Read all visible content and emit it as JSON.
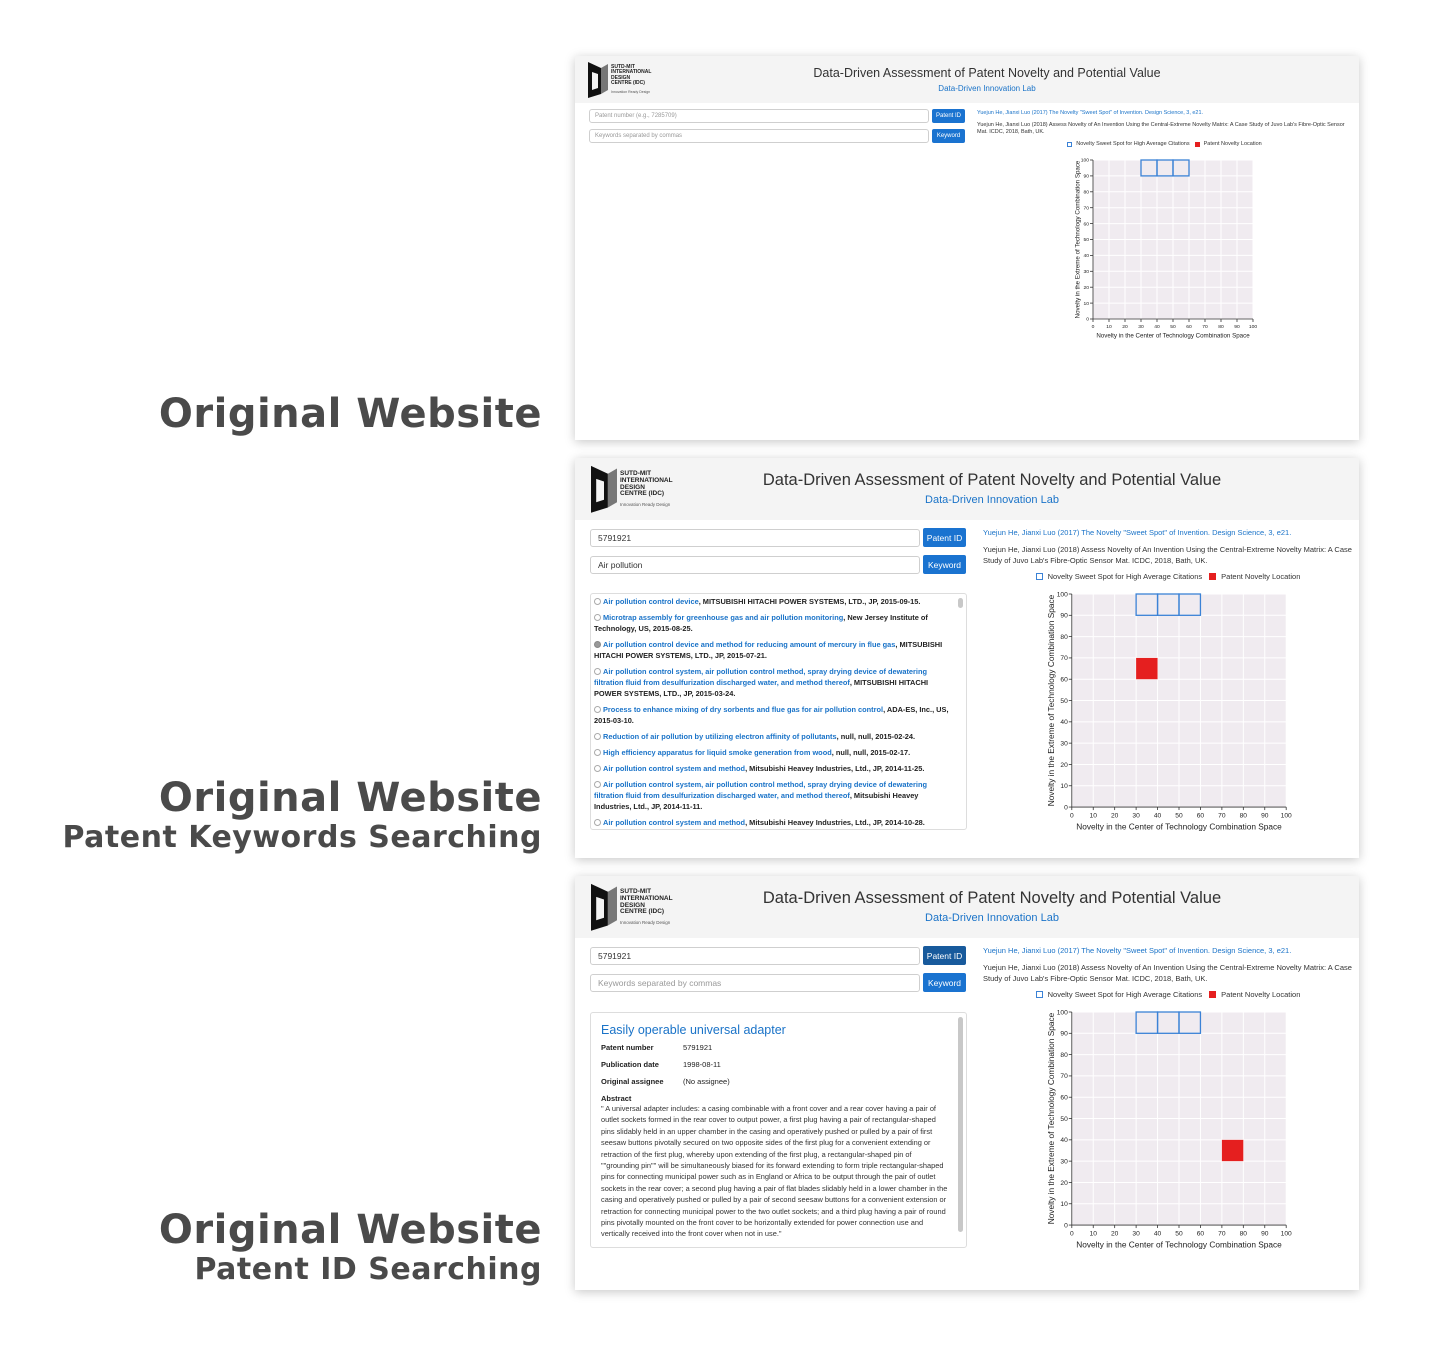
{
  "captions": [
    {
      "main": "Original Website",
      "sub": ""
    },
    {
      "main": "Original Website",
      "sub": "Patent Keywords Searching"
    },
    {
      "main": "Original Website",
      "sub": "Patent ID Searching"
    }
  ],
  "header": {
    "logo_lines": [
      "SUTD-MIT",
      "INTERNATIONAL",
      "DESIGN",
      "CENTRE (IDC)"
    ],
    "logo_tagline": "Innovation Ready Design",
    "title": "Data-Driven Assessment of Patent Novelty and Potential Value",
    "subtitle": "Data-Driven Innovation Lab"
  },
  "search": {
    "patent_placeholder": "Patent number (e.g., 7285709)",
    "keyword_placeholder": "Keywords separated by commas",
    "patent_button": "Patent ID",
    "keyword_button": "Keyword"
  },
  "references": {
    "ref1": "Yuejun He, Jianxi Luo (2017) The Novelty \"Sweet Spot\" of Invention. Design Science, 3, e21.",
    "ref2": "Yuejun He, Jianxi Luo (2018) Assess Novelty of An Invention Using the Central-Extreme Novelty Matrix: A Case Study of Juvo Lab's Fibre-Optic Sensor Mat. ICDC, 2018, Bath, UK."
  },
  "legend": {
    "sweet_spot": "Novelty Sweet Spot for High Average Citations",
    "location": "Patent Novelty Location"
  },
  "screens": [
    {
      "patent_value": "",
      "keyword_value": ""
    },
    {
      "patent_value": "5791921",
      "keyword_value": "Air pollution",
      "results": [
        {
          "title": "Air pollution control device",
          "rest": ", MITSUBISHI HITACHI POWER SYSTEMS, LTD., JP, 2015-09-15.",
          "selected": false
        },
        {
          "title": "Microtrap assembly for greenhouse gas and air pollution monitoring",
          "rest": ", New Jersey Institute of Technology, US, 2015-08-25.",
          "selected": false
        },
        {
          "title": "Air pollution control device and method for reducing amount of mercury in flue gas",
          "rest": ", MITSUBISHI HITACHI POWER SYSTEMS, LTD., JP, 2015-07-21.",
          "selected": true
        },
        {
          "title": "Air pollution control system, air pollution control method, spray drying device of dewatering filtration fluid from desulfurization discharged water, and method thereof",
          "rest": ", MITSUBISHI HITACHI POWER SYSTEMS, LTD., JP, 2015-03-24.",
          "selected": false
        },
        {
          "title": "Process to enhance mixing of dry sorbents and flue gas for air pollution control",
          "rest": ", ADA-ES, Inc., US, 2015-03-10.",
          "selected": false
        },
        {
          "title": "Reduction of air pollution by utilizing electron affinity of pollutants",
          "rest": ", null, null, 2015-02-24.",
          "selected": false
        },
        {
          "title": "High efficiency apparatus for liquid smoke generation from wood",
          "rest": ", null, null, 2015-02-17.",
          "selected": false
        },
        {
          "title": "Air pollution control system and method",
          "rest": ", Mitsubishi Heavey Industries, Ltd., JP, 2014-11-25.",
          "selected": false
        },
        {
          "title": "Air pollution control system, air pollution control method, spray drying device of dewatering filtration fluid from desulfurization discharged water, and method thereof",
          "rest": ", Mitsubishi Heavey Industries, Ltd., JP, 2014-11-11.",
          "selected": false
        },
        {
          "title": "Air pollution control system and method",
          "rest": ", Mitsubishi Heavey Industries, Ltd., JP, 2014-10-28.",
          "selected": false
        }
      ]
    },
    {
      "patent_value": "5791921",
      "keyword_value": "",
      "detail": {
        "title": "Easily operable universal adapter",
        "fields": [
          {
            "key": "Patent number",
            "value": "5791921"
          },
          {
            "key": "Publication date",
            "value": "1998-08-11"
          },
          {
            "key": "Original assignee",
            "value": "(No assignee)"
          }
        ],
        "abstract_label": "Abstract",
        "abstract": "\" A universal adapter includes: a casing combinable with a front cover and a rear cover having a pair of outlet sockets formed in the rear cover to output power, a first plug having a pair of rectangular-shaped pins slidably held in an upper chamber in the casing and operatively pushed or pulled by a pair of first seesaw buttons pivotally secured on two opposite sides of the first plug for a convenient extending or retraction of the first plug, whereby upon extending of the first plug, a rectangular-shaped pin of \"\"grounding pin\"\" will be simultaneously biased for its forward extending to form triple rectangular-shaped pins for connecting municipal power such as in England or Africa to be output through the pair of outlet sockets in the rear cover; a second plug having a pair of flat blades slidably held in a lower chamber in the casing and operatively pushed or pulled by a pair of second seesaw buttons for a convenient extension or retraction for connecting municipal power to the two outlet sockets; and a third plug having a pair of round pins pivotally mounted on the front cover to be horizontally extended for power connection use and vertically received into the front cover when not in use.\""
      }
    }
  ],
  "colors": {
    "accent": "#1a73d0",
    "sweet_spot": "#3b82d6",
    "location": "#e51f1f",
    "plot_bg": "#f0ebf0"
  },
  "chart_data": [
    {
      "type": "scatter",
      "title": "",
      "xlabel": "Novelty in the Center of Technology Combination Space",
      "ylabel": "Novelty in the Extreme of Technology Combination Space",
      "xlim": [
        0,
        100
      ],
      "ylim": [
        0,
        100
      ],
      "xticks": [
        0,
        10,
        20,
        30,
        40,
        50,
        60,
        70,
        80,
        90,
        100
      ],
      "yticks": [
        0,
        10,
        20,
        30,
        40,
        50,
        60,
        70,
        80,
        90,
        100
      ],
      "grid": true,
      "legend": "top",
      "sweet_spot_cells": [
        {
          "x": [
            30,
            40
          ],
          "y": [
            90,
            100
          ]
        },
        {
          "x": [
            40,
            50
          ],
          "y": [
            90,
            100
          ]
        },
        {
          "x": [
            50,
            60
          ],
          "y": [
            90,
            100
          ]
        }
      ],
      "patent_location": null
    },
    {
      "type": "scatter",
      "title": "",
      "xlabel": "Novelty in the Center of Technology Combination Space",
      "ylabel": "Novelty in the Extreme of Technology Combination Space",
      "xlim": [
        0,
        100
      ],
      "ylim": [
        0,
        100
      ],
      "xticks": [
        0,
        10,
        20,
        30,
        40,
        50,
        60,
        70,
        80,
        90,
        100
      ],
      "yticks": [
        0,
        10,
        20,
        30,
        40,
        50,
        60,
        70,
        80,
        90,
        100
      ],
      "grid": true,
      "legend": "top",
      "sweet_spot_cells": [
        {
          "x": [
            30,
            40
          ],
          "y": [
            90,
            100
          ]
        },
        {
          "x": [
            40,
            50
          ],
          "y": [
            90,
            100
          ]
        },
        {
          "x": [
            50,
            60
          ],
          "y": [
            90,
            100
          ]
        }
      ],
      "patent_location": {
        "x": [
          30,
          40
        ],
        "y": [
          60,
          70
        ]
      }
    },
    {
      "type": "scatter",
      "title": "",
      "xlabel": "Novelty in the Center of Technology Combination Space",
      "ylabel": "Novelty in the Extreme of Technology Combination Space",
      "xlim": [
        0,
        100
      ],
      "ylim": [
        0,
        100
      ],
      "xticks": [
        0,
        10,
        20,
        30,
        40,
        50,
        60,
        70,
        80,
        90,
        100
      ],
      "yticks": [
        0,
        10,
        20,
        30,
        40,
        50,
        60,
        70,
        80,
        90,
        100
      ],
      "grid": true,
      "legend": "top",
      "sweet_spot_cells": [
        {
          "x": [
            30,
            40
          ],
          "y": [
            90,
            100
          ]
        },
        {
          "x": [
            40,
            50
          ],
          "y": [
            90,
            100
          ]
        },
        {
          "x": [
            50,
            60
          ],
          "y": [
            90,
            100
          ]
        }
      ],
      "patent_location": {
        "x": [
          70,
          80
        ],
        "y": [
          30,
          40
        ]
      }
    }
  ]
}
